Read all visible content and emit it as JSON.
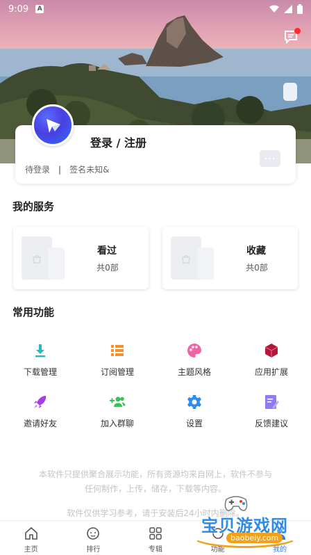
{
  "status_bar": {
    "time": "9:09",
    "notif_letter": "A"
  },
  "profile": {
    "login_title": "登录 / 注册",
    "pending": "待登录",
    "separator": "|",
    "signature": "签名未知&",
    "more_label": "···"
  },
  "services": {
    "title": "我的服务",
    "items": [
      {
        "name": "看过",
        "count": "共0部"
      },
      {
        "name": "收藏",
        "count": "共0部"
      }
    ]
  },
  "functions": {
    "title": "常用功能",
    "items": [
      {
        "label": "下载管理",
        "icon": "download-icon",
        "color": "#26b8c6"
      },
      {
        "label": "订阅管理",
        "icon": "list-icon",
        "color": "#f7902b"
      },
      {
        "label": "主题风格",
        "icon": "palette-icon",
        "color": "#f064a6"
      },
      {
        "label": "应用扩展",
        "icon": "cube-icon",
        "color": "#b3173a"
      },
      {
        "label": "邀请好友",
        "icon": "rocket-icon",
        "color": "#a33fe8"
      },
      {
        "label": "加入群聊",
        "icon": "group-add-icon",
        "color": "#3bbf5a"
      },
      {
        "label": "设置",
        "icon": "gear-icon",
        "color": "#2d8ef0"
      },
      {
        "label": "反馈建议",
        "icon": "feedback-icon",
        "color": "#8e7bf5"
      }
    ]
  },
  "disclaimer": {
    "line1": "本软件只提供聚合展示功能，所有资源均来自网上，软件不参与",
    "line2": "任何制作，上传，储存，下载等内容。",
    "line3": "软件仅供学习参考，请于安装后24小时内删除。"
  },
  "bottom_nav": [
    {
      "label": "主页",
      "icon": "home-icon"
    },
    {
      "label": "排行",
      "icon": "rank-icon"
    },
    {
      "label": "专辑",
      "icon": "album-icon"
    },
    {
      "label": "功能",
      "icon": "function-icon"
    },
    {
      "label": "我的",
      "icon": "user-icon",
      "active": true
    }
  ],
  "watermark": {
    "name": "宝贝游戏网",
    "url": "baobeiy.com"
  },
  "colors": {
    "accent": "#2f7cf6"
  }
}
